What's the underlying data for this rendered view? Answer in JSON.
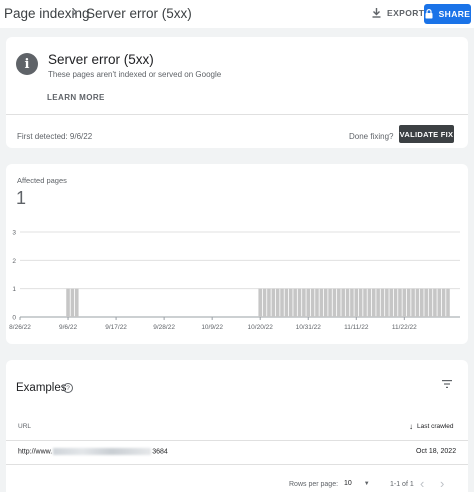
{
  "header": {
    "breadcrumb_parent": "Page indexing",
    "breadcrumb_current": "Server error (5xx)",
    "export_label": "EXPORT",
    "share_label": "SHARE",
    "accent_color": "#1a73e8"
  },
  "issue": {
    "icon": "info-icon",
    "title": "Server error (5xx)",
    "subtitle": "These pages aren't indexed or served on Google",
    "learn_more": "LEARN MORE",
    "first_detected": "First detected: 9/6/22",
    "done_fixing": "Done fixing?",
    "validate_label": "VALIDATE FIX"
  },
  "affected": {
    "label": "Affected pages",
    "count": "1"
  },
  "chart_data": {
    "type": "bar",
    "title": "",
    "xlabel": "",
    "ylabel": "",
    "ylim": [
      0,
      3
    ],
    "yticks": [
      "0",
      "1",
      "2",
      "3"
    ],
    "x_ticks": [
      "8/26/22",
      "9/6/22",
      "9/17/22",
      "9/28/22",
      "10/9/22",
      "10/20/22",
      "10/31/22",
      "11/11/22",
      "11/22/22"
    ],
    "start_date": "8/26/22",
    "series": [
      {
        "values": [
          0,
          0,
          0,
          0,
          0,
          0,
          0,
          0,
          0,
          0,
          0,
          1,
          1,
          1,
          0,
          0,
          0,
          0,
          0,
          0,
          0,
          0,
          0,
          0,
          0,
          0,
          0,
          0,
          0,
          0,
          0,
          0,
          0,
          0,
          0,
          0,
          0,
          0,
          0,
          0,
          0,
          0,
          0,
          0,
          0,
          0,
          0,
          0,
          0,
          0,
          0,
          0,
          0,
          0,
          0,
          1,
          1,
          1,
          1,
          1,
          1,
          1,
          1,
          1,
          1,
          1,
          1,
          1,
          1,
          1,
          1,
          1,
          1,
          1,
          1,
          1,
          1,
          1,
          1,
          1,
          1,
          1,
          1,
          1,
          1,
          1,
          1,
          1,
          1,
          1,
          1,
          1,
          1,
          1,
          1,
          1,
          1,
          1,
          1
        ]
      }
    ],
    "grid": true,
    "bar_color": "#c6c6c6"
  },
  "examples": {
    "title": "Examples",
    "help_icon": "help-icon",
    "filter_icon": "filter-icon",
    "col_url": "URL",
    "col_crawled": "Last crawled",
    "rows": [
      {
        "url_prefix": "http://www.",
        "url_suffix": "3684",
        "date": "Oct 18, 2022"
      }
    ],
    "rows_per_page_label": "Rows per page:",
    "rows_per_page": "10",
    "range": "1-1 of 1"
  }
}
